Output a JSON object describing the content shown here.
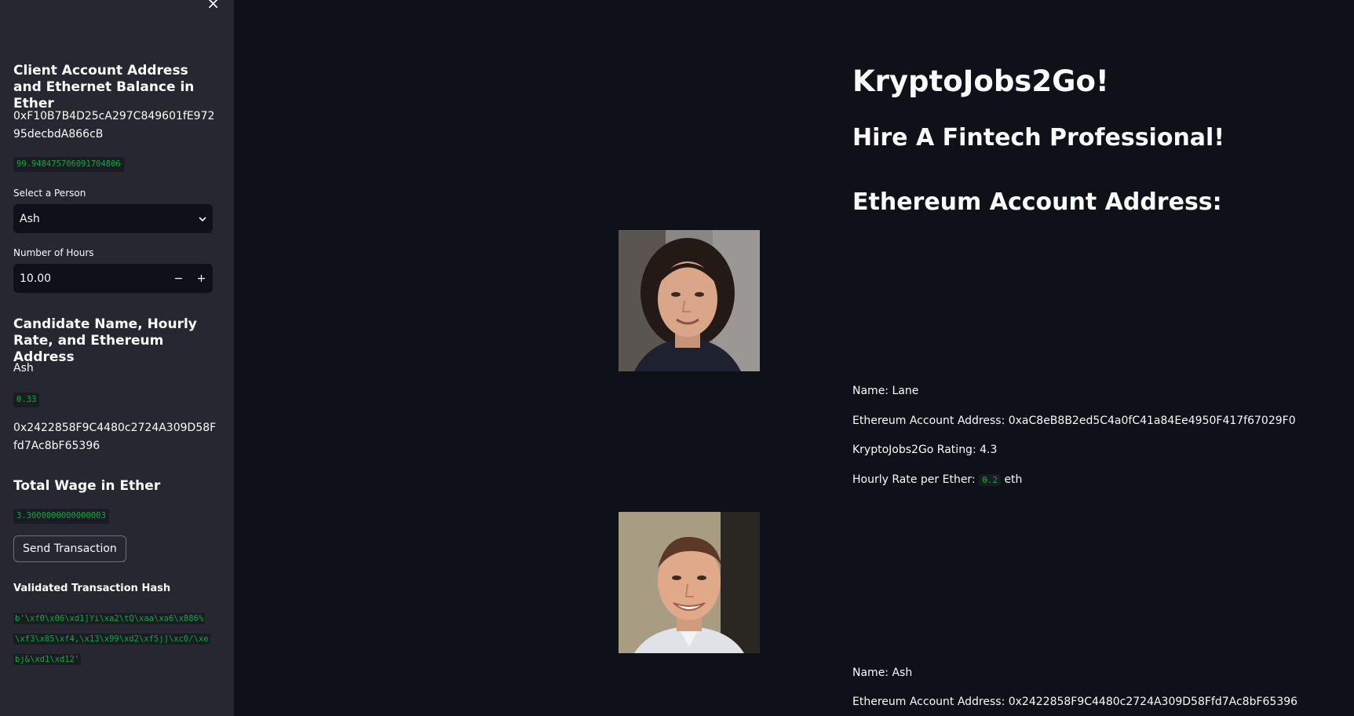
{
  "sidebar": {
    "close_label": "×",
    "account_heading": "Client Account Address and Ethernet Balance in Ether",
    "account_address": "0xF10B7B4D25cA297C849601fE97295decbdA866cB",
    "account_balance": "99.948475706091704806",
    "person_select_label": "Select a Person",
    "person_select_value": "Ash",
    "hours_label": "Number of Hours",
    "hours_value": "10.00",
    "hours_decrement": "−",
    "hours_increment": "+",
    "candidate_heading": "Candidate Name, Hourly Rate, and Ethereum Address",
    "candidate_name": "Ash",
    "candidate_rate": "0.33",
    "candidate_address": "0x2422858F9C4480c2724A309D58Ffd7Ac8bF65396",
    "wage_heading": "Total Wage in Ether",
    "wage_value": "3.3000000000000003",
    "send_button": "Send Transaction",
    "hash_heading": "Validated Transaction Hash",
    "hash_value": "b'\\xf0\\x06\\xd1]Yi\\xa2\\tQ\\xaa\\xa6\\x886%\\xf3\\x85\\xf4,\\x13\\x99\\xd2\\xf5j]\\xc0/\\xebj&\\xd1\\xd12'"
  },
  "main": {
    "title": "KryptoJobs2Go!",
    "subtitle": "Hire A Fintech Professional!",
    "section_heading": "Ethereum Account Address:",
    "candidates": [
      {
        "name_line": "Name: Lane",
        "address_line": "Ethereum Account Address: 0xaC8eB8B2ed5C4a0fC41a84Ee4950F417f67029F0",
        "rating_line": "KryptoJobs2Go Rating: 4.3",
        "rate_prefix": "Hourly Rate per Ether:",
        "rate_value": "0.2",
        "rate_suffix": "eth"
      },
      {
        "name_line": "Name: Ash",
        "address_line": "Ethereum Account Address: 0x2422858F9C4480c2724A309D58Ffd7Ac8bF65396"
      }
    ]
  }
}
